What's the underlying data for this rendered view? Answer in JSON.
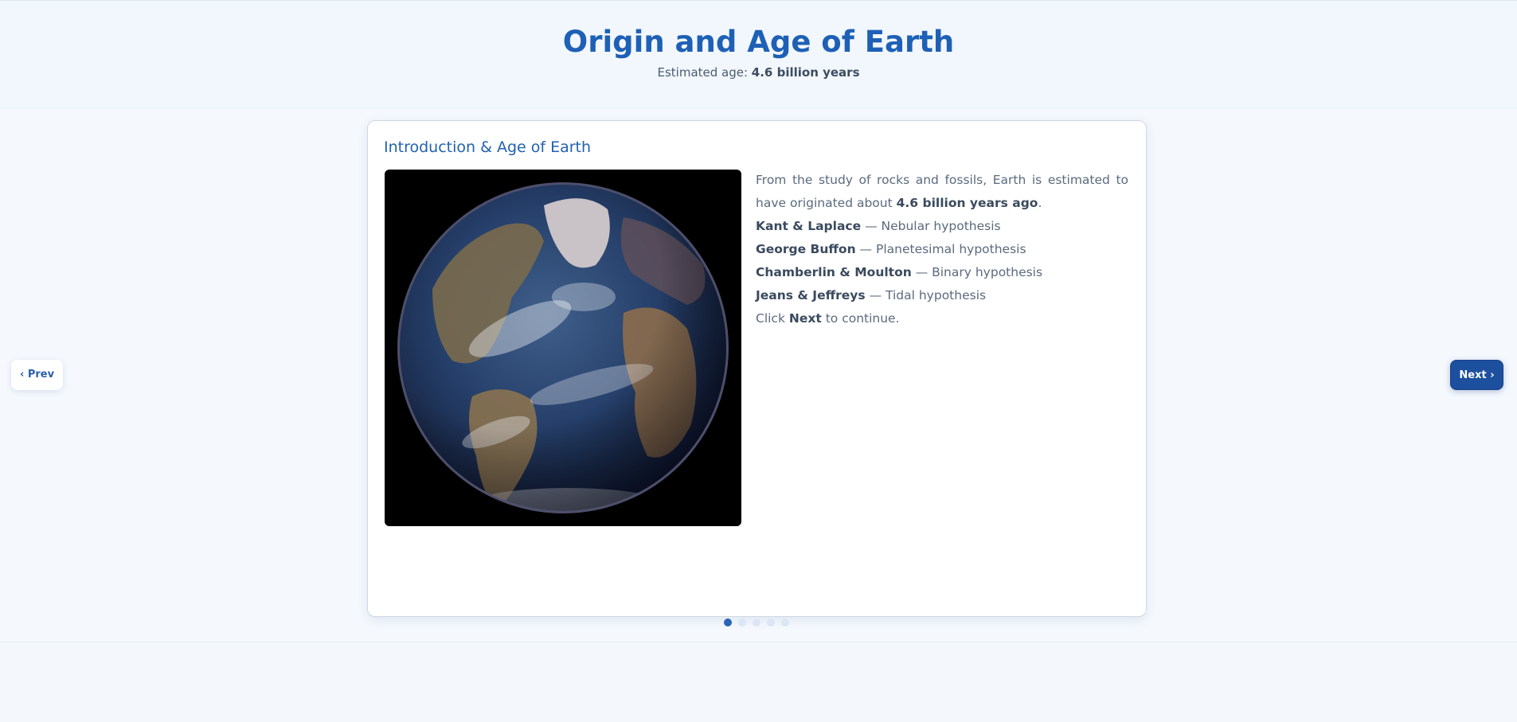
{
  "header": {
    "title": "Origin and Age of Earth",
    "subtitle_prefix": "Estimated age: ",
    "subtitle_value": "4.6 billion years"
  },
  "slide": {
    "title": "Introduction & Age of Earth",
    "image_alt": "earth-globe-image",
    "intro_pre": "From the study of rocks and fossils, Earth is estimated to have originated about ",
    "intro_bold": "4.6 billion years ago",
    "intro_post": ".",
    "hypotheses": [
      {
        "who": "Kant & Laplace",
        "what": " — Nebular hypothesis"
      },
      {
        "who": "George Buffon",
        "what": " — Planetesimal hypothesis"
      },
      {
        "who": "Chamberlin & Moulton",
        "what": " — Binary hypothesis"
      },
      {
        "who": "Jeans & Jeffreys",
        "what": " — Tidal hypothesis"
      }
    ],
    "cta_pre": "Click ",
    "cta_bold": "Next",
    "cta_post": " to continue."
  },
  "nav": {
    "prev_label": "‹ Prev",
    "next_label": "Next ›"
  },
  "pagination": {
    "total": 5,
    "current": 1
  },
  "colors": {
    "accent": "#1e60b5",
    "next_button": "#1d4f9f",
    "dot_active": "#2a63b8",
    "dot_inactive": "#dbe6f5"
  }
}
